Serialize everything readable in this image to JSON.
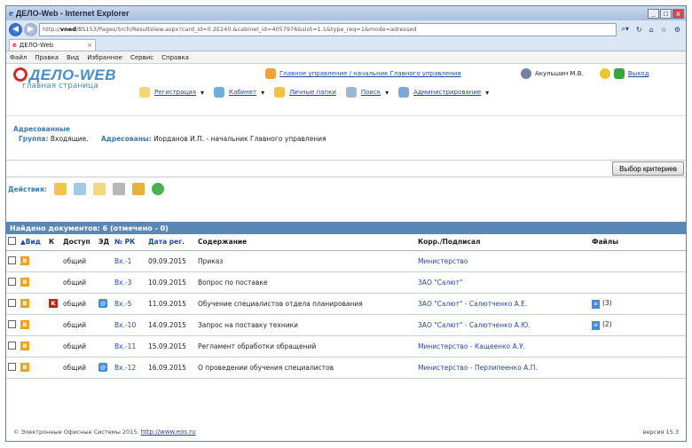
{
  "window": {
    "title": "ДЕЛО-Web - Internet Explorer"
  },
  "browser": {
    "address_host": "vned",
    "address_path": "/BS153/Pages/Srch/ResultView.aspx?card_id=0.2E240.&cabinet_id=4057976&slot=1.1&type_req=1&mode=adressed",
    "tab_label": "ДЕЛО-Web",
    "tab_close": "×",
    "menu": [
      "Файл",
      "Правка",
      "Вид",
      "Избранное",
      "Сервис",
      "Справка"
    ]
  },
  "app": {
    "logo_text": "ДЕЛО-WEB",
    "logo_subtitle": "главная страница",
    "org_link": "Главное управление / начальник Главного управления",
    "user_name": "Акульшин М.В.",
    "logout_label": "Выход",
    "nav": [
      {
        "label": "Регистрация"
      },
      {
        "label": "Кабинет"
      },
      {
        "label": "Личные папки"
      },
      {
        "label": "Поиск"
      },
      {
        "label": "Администрирование"
      }
    ]
  },
  "addressed": {
    "heading": "Адресованные",
    "group_label": "Группа:",
    "group_value": "Входящие.",
    "addressed_label": "Адресованы:",
    "addressed_value": "Иорданов И.П. - начальник Главного управления"
  },
  "criteria_button": "Выбор критериев",
  "actions_label": "Действия:",
  "found_bar": "Найдено документов: 6 (отмечено - 0)",
  "columns": [
    "Вид",
    "К",
    "Доступ",
    "ЭД",
    "№ РК",
    "Дата рег.",
    "Содержание",
    "Корр./Подписал",
    "Файлы"
  ],
  "rows": [
    {
      "kind_icon": "B",
      "k": "",
      "access": "общий",
      "ed": "",
      "rk": "Вх.-1",
      "date": "09.09.2015",
      "content": "Приказ",
      "corr": "Министерство",
      "files": ""
    },
    {
      "kind_icon": "B",
      "k": "",
      "access": "общий",
      "ed": "",
      "rk": "Вх.-3",
      "date": "10.09.2015",
      "content": "Вопрос по поставке",
      "corr": "ЗАО \"Салют\"",
      "files": ""
    },
    {
      "kind_icon": "B",
      "k": "K",
      "access": "общий",
      "ed": "@",
      "rk": "Вх.-5",
      "date": "11.09.2015",
      "content": "Обучение специалистов отдела планирования",
      "corr": "ЗАО \"Салют\" - Салютченко А.Е.",
      "files": "(3)"
    },
    {
      "kind_icon": "B",
      "k": "",
      "access": "общий",
      "ed": "",
      "rk": "Вх.-10",
      "date": "14.09.2015",
      "content": "Запрос на поставку техники",
      "corr": "ЗАО \"Салют\" - Салютченко А.Ю.",
      "files": "(2)"
    },
    {
      "kind_icon": "B",
      "k": "",
      "access": "общий",
      "ed": "",
      "rk": "Вх.-11",
      "date": "15.09.2015",
      "content": "Регламент обработки обращений",
      "corr": "Министерство - Кащеенко А.У.",
      "files": ""
    },
    {
      "kind_icon": "B",
      "k": "",
      "access": "общий",
      "ed": "@",
      "rk": "Вх.-12",
      "date": "16.09.2015",
      "content": "О проведении обучения специалистов",
      "corr": "Министерство - Перлипеенко А.П.",
      "files": ""
    }
  ],
  "footer": {
    "copyright": "© Электронные Офисные Системы 2015.",
    "link": "http://www.eos.ru",
    "version": "версия 15.3"
  }
}
